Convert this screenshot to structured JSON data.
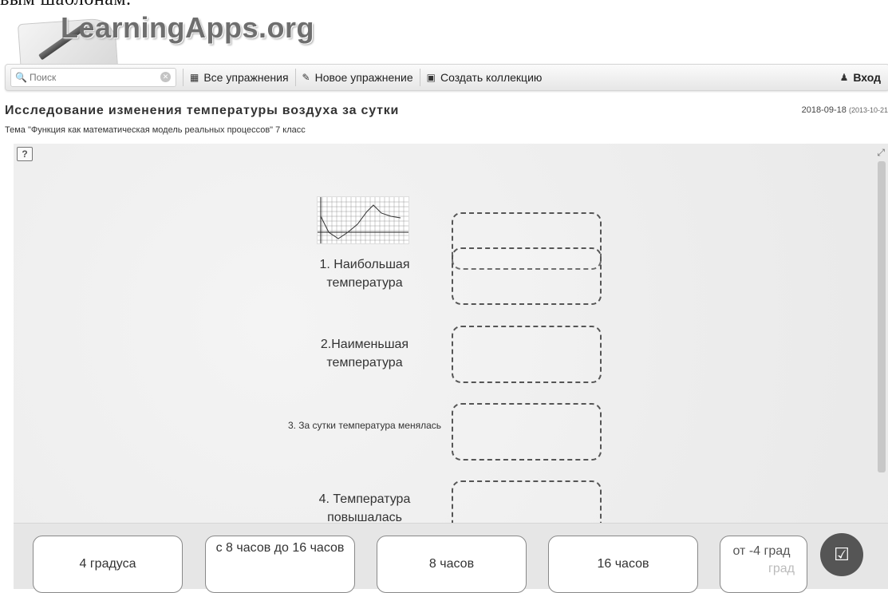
{
  "doc_caption_fragment": "вым шаблонам.",
  "logo": {
    "text": "LearningApps.org"
  },
  "nav": {
    "search_placeholder": "Поиск",
    "all_exercises": "Все упражнения",
    "new_exercise": "Новое упражнение",
    "create_collection": "Создать коллекцию",
    "login": "Вход"
  },
  "page": {
    "title": "Исследование изменения температуры воздуха за сутки",
    "subtitle": "Тема \"Функция как математическая модель реальных процессов\" 7 класс",
    "date": "2018-09-18",
    "date_created": "(2013-10-21"
  },
  "rows": [
    {
      "label": "1. Наибольшая температура"
    },
    {
      "label": "2.Наименьшая температура"
    },
    {
      "label": "3. За сутки температура менялась"
    },
    {
      "label": "4. Температура повышалась"
    }
  ],
  "cards": [
    {
      "text": "4 градуса"
    },
    {
      "text": "с 8 часов до 16 часов"
    },
    {
      "text": "8 часов"
    },
    {
      "text": "16 часов"
    },
    {
      "text_visible": "от -4 град",
      "text_faded": "град"
    }
  ]
}
